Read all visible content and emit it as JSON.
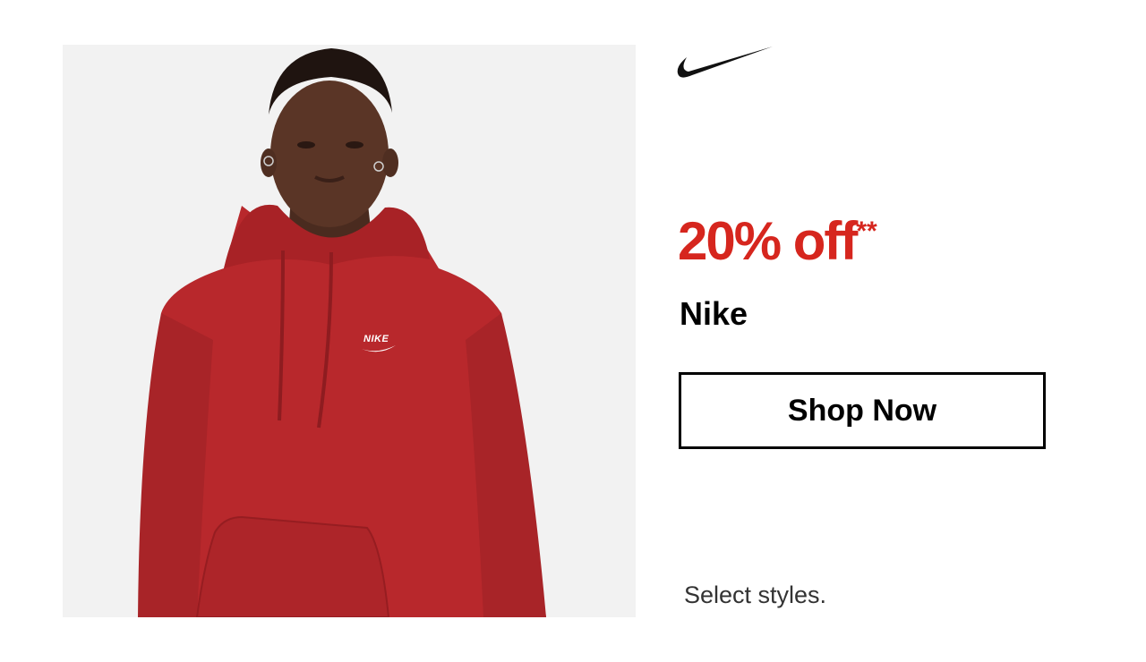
{
  "promo": {
    "discount": "20% off",
    "discount_mark": "**",
    "brand": "Nike",
    "cta_label": "Shop Now",
    "footnote": "Select styles.",
    "product_logo_text": "NIKE"
  },
  "colors": {
    "accent": "#d6261e",
    "hoodie": "#b8282c",
    "photo_bg": "#f2f2f2",
    "text": "#000000"
  },
  "icons": {
    "logo": "nike-swoosh-logo"
  }
}
